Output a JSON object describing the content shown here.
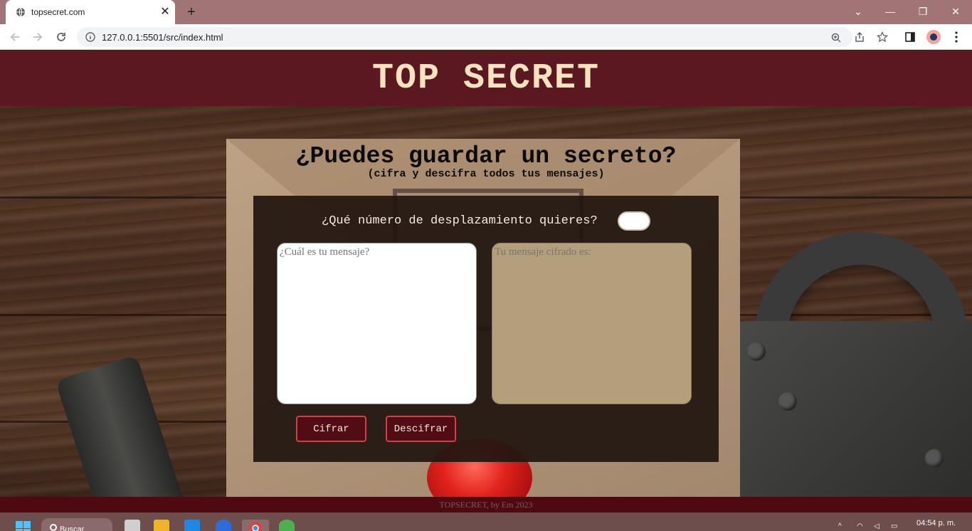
{
  "browser": {
    "tab_title": "topsecret.com",
    "url": "127.0.0.1:5501/src/index.html"
  },
  "page": {
    "site_title": "TOP SECRET",
    "heading": "¿Puedes guardar un secreto?",
    "subheading": "(cifra y descifra todos tus mensajes)",
    "shift_label": "¿Qué número de desplazamiento quieres?",
    "shift_value": "",
    "message_placeholder": "¿Cuál es tu mensaje?",
    "output_placeholder": "Tu mensaje cifrado es:",
    "encrypt_label": "Cifrar",
    "decrypt_label": "Descifrar",
    "footer": "TOPSECRET, by Em 2023"
  },
  "taskbar": {
    "search_label": "Buscar",
    "clock": "04:54 p. m."
  },
  "colors": {
    "header": "#5c1820",
    "title": "#fbe3c1",
    "panel": "#211610",
    "output_box": "#b39f7c",
    "button": "#520c14",
    "button_border": "#c5454a"
  }
}
